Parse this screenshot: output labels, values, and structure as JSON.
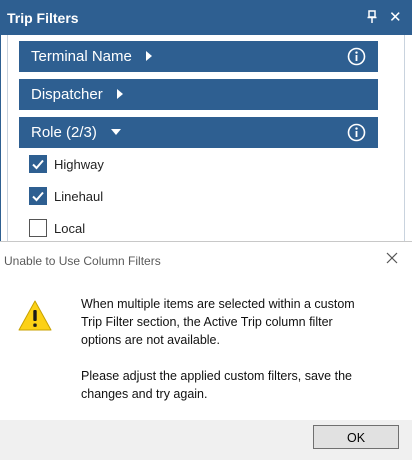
{
  "panel": {
    "title": "Trip Filters",
    "sections": [
      {
        "label": "Terminal Name",
        "expanded": false,
        "has_info": true
      },
      {
        "label": "Dispatcher",
        "expanded": false,
        "has_info": false
      },
      {
        "label": "Role (2/3)",
        "expanded": true,
        "has_info": true
      }
    ],
    "role_options": [
      {
        "label": "Highway",
        "checked": true
      },
      {
        "label": "Linehaul",
        "checked": true
      },
      {
        "label": "Local",
        "checked": false
      }
    ]
  },
  "dialog": {
    "title": "Unable to Use Column Filters",
    "message_lines_1": [
      "When multiple items are selected within a custom",
      "Trip Filter section, the Active Trip column filter",
      "options are not available."
    ],
    "message_lines_2": [
      "Please adjust the applied custom filters, save the",
      "changes and try again."
    ],
    "ok_label": "OK"
  },
  "colors": {
    "accent": "#2e5f91",
    "warning_fill": "#fcd116"
  }
}
